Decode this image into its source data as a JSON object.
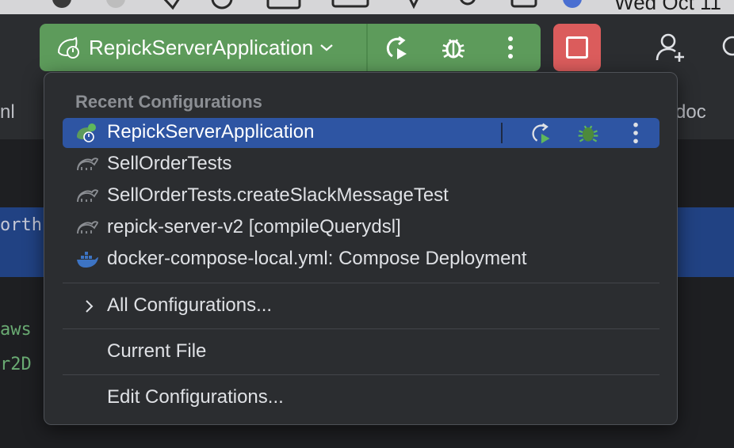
{
  "menubar": {
    "clock": "Wed Oct 11"
  },
  "toolbar": {
    "run_config_label": "RepickServerApplication",
    "colors": {
      "run_widget": "#5d9b5b",
      "stop": "#db5c5c"
    }
  },
  "editor": {
    "tab_left": "nl",
    "tab_right": "doc",
    "code_lines": [
      "orth",
      "aws",
      "r2D"
    ]
  },
  "popup": {
    "section_title": "Recent Configurations",
    "recent": [
      {
        "label": "RepickServerApplication",
        "icon": "spring-boot-icon",
        "selected": true
      },
      {
        "label": "SellOrderTests",
        "icon": "gradle-icon",
        "selected": false
      },
      {
        "label": "SellOrderTests.createSlackMessageTest",
        "icon": "gradle-icon",
        "selected": false
      },
      {
        "label": "repick-server-v2 [compileQuerydsl]",
        "icon": "gradle-icon",
        "selected": false
      },
      {
        "label": "docker-compose-local.yml: Compose Deployment",
        "icon": "docker-icon",
        "selected": false
      }
    ],
    "all_configurations": "All Configurations...",
    "current_file": "Current File",
    "edit_configurations": "Edit Configurations...",
    "colors": {
      "selected": "#2e55a3"
    }
  }
}
